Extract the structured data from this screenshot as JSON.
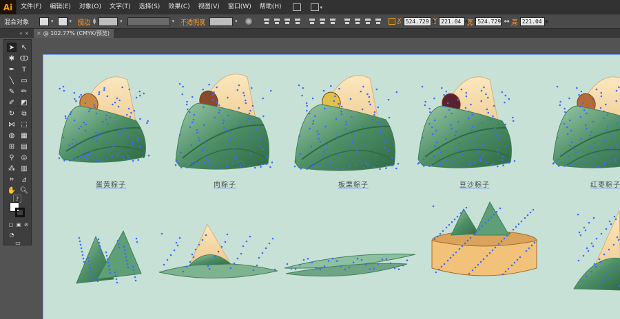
{
  "app": {
    "logo": "Ai"
  },
  "menu": [
    "文件(F)",
    "编辑(E)",
    "对象(O)",
    "文字(T)",
    "选择(S)",
    "效果(C)",
    "视图(V)",
    "窗口(W)",
    "帮助(H)"
  ],
  "control_bar": {
    "object_type": "混合对象",
    "stroke_label": "描边",
    "opacity_label": "不透明度",
    "x_label": "X",
    "x_value": "524.729 i",
    "y_label": "Y",
    "y_value": "221.04 m",
    "w_label": "宽",
    "w_value": "524.729 i",
    "h_label": "高",
    "h_value": "221.04 m"
  },
  "document_tab": {
    "title": "@ 102.77% (CMYK/预览)",
    "close": "×"
  },
  "panel_grip": "«  ×",
  "tools": [
    "selection",
    "direct-selection",
    "magic-wand",
    "lasso",
    "pen",
    "type",
    "line",
    "rectangle",
    "paintbrush",
    "pencil",
    "blob-brush",
    "eraser",
    "rotate",
    "scale",
    "width",
    "free-transform",
    "shape-builder",
    "perspective-grid",
    "mesh",
    "gradient",
    "eyedropper",
    "blend",
    "symbol-sprayer",
    "column-graph",
    "artboard",
    "slice",
    "hand",
    "zoom"
  ],
  "artboard": {
    "background": "#c8e1d7",
    "labels": [
      "蛋黄粽子",
      "肉粽子",
      "板栗粽子",
      "豆沙粽子",
      "红枣粽子"
    ]
  },
  "colors": {
    "leaf_dark": "#3f7f58",
    "leaf_light": "#8cc0a0",
    "rice": "#f3d9a8",
    "anchor": "#3d6bff",
    "steamer": "#f2c27a"
  },
  "help_icon": "?"
}
